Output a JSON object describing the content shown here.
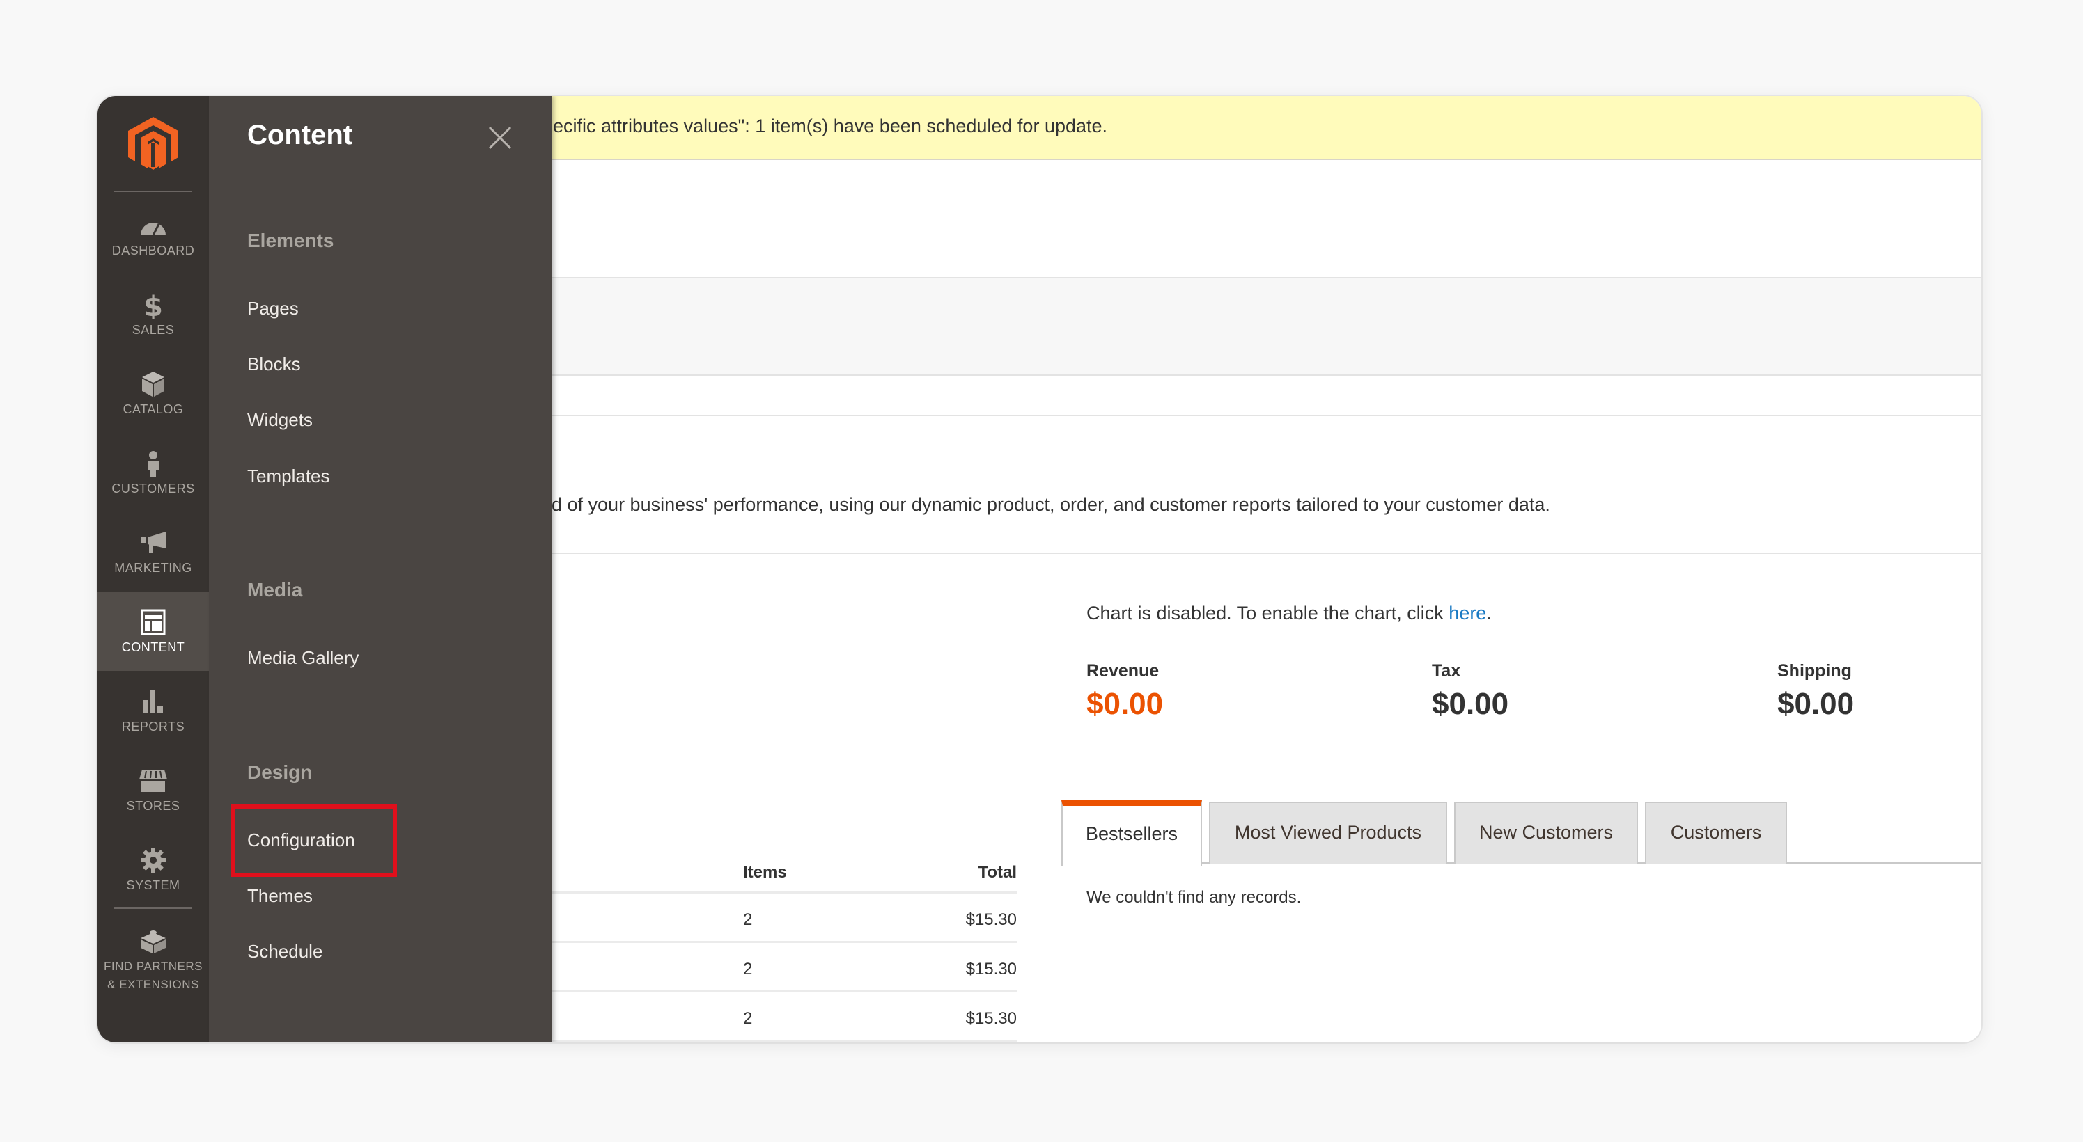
{
  "rail": {
    "logo": "magento-logo",
    "items": [
      {
        "label": "Dashboard",
        "icon": "dashboard-icon",
        "active": false
      },
      {
        "label": "Sales",
        "icon": "dollar-icon",
        "active": false
      },
      {
        "label": "Catalog",
        "icon": "box-icon",
        "active": false
      },
      {
        "label": "Customers",
        "icon": "person-icon",
        "active": false
      },
      {
        "label": "Marketing",
        "icon": "megaphone-icon",
        "active": false
      },
      {
        "label": "Content",
        "icon": "layout-icon",
        "active": true
      },
      {
        "label": "Reports",
        "icon": "bar-chart-icon",
        "active": false
      },
      {
        "label": "Stores",
        "icon": "storefront-icon",
        "active": false
      },
      {
        "label": "System",
        "icon": "gear-icon",
        "active": false
      },
      {
        "label": "Find Partners",
        "label2": "& Extensions",
        "icon": "extension-box-icon",
        "active": false
      }
    ]
  },
  "flyout": {
    "title": "Content",
    "groups": [
      {
        "title": "Elements",
        "links": [
          "Pages",
          "Blocks",
          "Widgets",
          "Templates"
        ]
      },
      {
        "title": "Media",
        "links": [
          "Media Gallery"
        ]
      },
      {
        "title": "Design",
        "links": [
          "Configuration",
          "Themes",
          "Schedule"
        ]
      }
    ],
    "highlighted_link": "Configuration"
  },
  "notice": {
    "text": "ecific attributes values\": 1 item(s) have been scheduled for update."
  },
  "description": {
    "text": "d of your business' performance, using our dynamic product, order, and customer reports tailored to your customer data."
  },
  "chart": {
    "message": "Chart is disabled. To enable the chart, click ",
    "link": "here",
    "suffix": "."
  },
  "metrics": [
    {
      "label": "Revenue",
      "value": "$0.00",
      "color": "#eb5202"
    },
    {
      "label": "Tax",
      "value": "$0.00"
    },
    {
      "label": "Shipping",
      "value": "$0.00"
    }
  ],
  "orders_table": {
    "columns": [
      "Items",
      "Total"
    ],
    "rows": [
      {
        "items": "2",
        "total": "$15.30"
      },
      {
        "items": "2",
        "total": "$15.30"
      },
      {
        "items": "2",
        "total": "$15.30"
      }
    ]
  },
  "tabs": {
    "items": [
      "Bestsellers",
      "Most Viewed Products",
      "New Customers",
      "Customers"
    ],
    "active": "Bestsellers",
    "empty_message": "We couldn't find any records."
  },
  "colors": {
    "accent": "#eb5202",
    "rail_bg": "#373330",
    "flyout_bg": "#4a4542",
    "notice_bg": "#fffbbb",
    "link": "#1979c3",
    "highlight_box": "#e0101c"
  }
}
